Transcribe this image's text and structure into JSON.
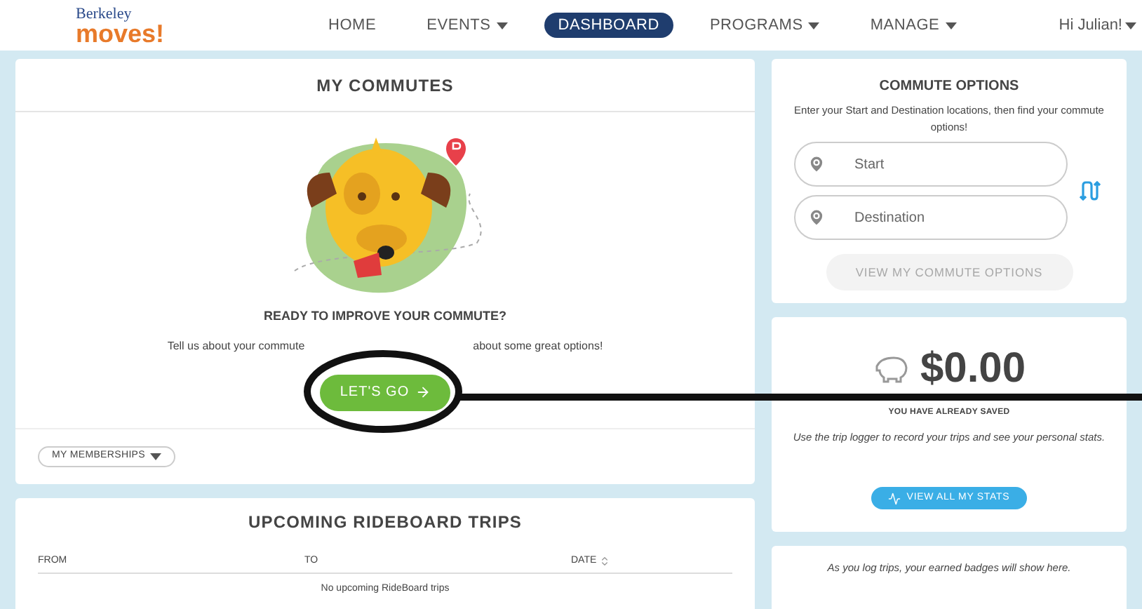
{
  "header": {
    "logo_top": "Berkeley",
    "logo_bottom": "moves!",
    "nav": [
      {
        "label": "HOME",
        "selected": false,
        "dropdown": false
      },
      {
        "label": "EVENTS",
        "selected": false,
        "dropdown": true
      },
      {
        "label": "DASHBOARD",
        "selected": true,
        "dropdown": false
      },
      {
        "label": "PROGRAMS",
        "selected": false,
        "dropdown": true
      },
      {
        "label": "MANAGE",
        "selected": false,
        "dropdown": true
      }
    ],
    "user": "Hi Julian!"
  },
  "my_commutes": {
    "title": "MY COMMUTES",
    "heading": "READY TO IMPROVE YOUR COMMUTE?",
    "text_left": "Tell us about your commute",
    "text_right": "about some great options!",
    "button": "LET'S GO",
    "memberships": "MY MEMBERSHIPS"
  },
  "rideboard": {
    "title": "UPCOMING RIDEBOARD TRIPS",
    "columns": [
      {
        "label": "FROM",
        "sortable": false
      },
      {
        "label": "TO",
        "sortable": false
      },
      {
        "label": "DATE",
        "sortable": true
      }
    ],
    "empty": "No upcoming RideBoard trips"
  },
  "commute_options": {
    "title": "COMMUTE OPTIONS",
    "text": "Enter your Start and Destination locations, then find your commute options!",
    "start": {
      "placeholder": "Start"
    },
    "destination": {
      "placeholder": "Destination"
    },
    "button": {
      "label": "VIEW MY COMMUTE OPTIONS",
      "disabled": true
    }
  },
  "savings": {
    "amount": "$0.00",
    "caption": "YOU HAVE ALREADY SAVED",
    "text": "Use the trip logger to record your trips and see your personal stats.",
    "button": "VIEW ALL MY STATS"
  },
  "badges": {
    "text": "As you log trips, your earned badges will show here."
  },
  "annotation": {
    "shown": true
  }
}
